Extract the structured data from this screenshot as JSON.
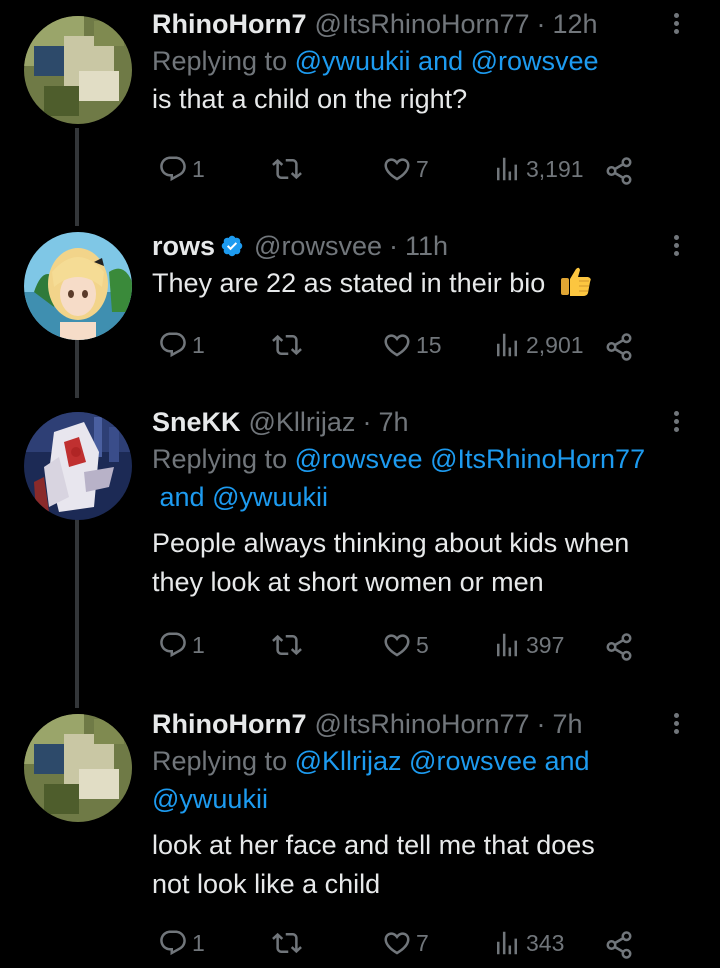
{
  "tweets": [
    {
      "name": "RhinoHorn7",
      "handle": "@ItsRhinoHorn77",
      "time": "12h",
      "replying_prefix": "Replying to",
      "replying_parts": [
        "@ywuukii",
        " and ",
        "@rowsvee"
      ],
      "text": "is that a child on the right?",
      "replies": "1",
      "retweets": "",
      "likes": "7",
      "views": "3,191"
    },
    {
      "name": "rows",
      "verified": true,
      "handle": "@rowsvee",
      "time": "11h",
      "text": "They are 22 as stated in their bio",
      "emoji": "thumbs-up",
      "replies": "1",
      "retweets": "",
      "likes": "15",
      "views": "2,901"
    },
    {
      "name": "SneKK",
      "handle": "@Kllrijaz",
      "time": "7h",
      "replying_prefix": "Replying to",
      "replying_parts": [
        "@rowsvee",
        " ",
        "@ItsRhinoHorn77",
        " and ",
        "@ywuukii"
      ],
      "text_line1": "People always thinking about kids when",
      "text_line2": "they look at short women or men",
      "replies": "1",
      "retweets": "",
      "likes": "5",
      "views": "397"
    },
    {
      "name": "RhinoHorn7",
      "handle": "@ItsRhinoHorn77",
      "time": "7h",
      "replying_prefix": "Replying to",
      "replying_parts": [
        "@Kllrijaz",
        " ",
        "@rowsvee",
        " and ",
        "@ywuukii"
      ],
      "text_line1": "look at her face and tell me that does",
      "text_line2": "not look like a child",
      "replies": "1",
      "retweets": "",
      "likes": "7",
      "views": "343"
    }
  ],
  "colors": {
    "accent": "#1d9bf0",
    "muted": "#71767b",
    "text": "#e7e9ea",
    "background": "#000000"
  }
}
